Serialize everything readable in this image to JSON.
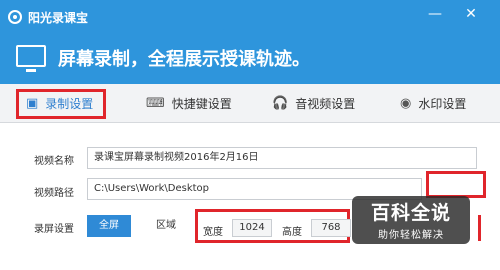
{
  "window": {
    "title": "阳光录课宝",
    "controls": [
      "—",
      "✕"
    ]
  },
  "header": {
    "slogan": "屏幕录制，全程展示授课轨迹。"
  },
  "tabs": [
    {
      "label": "录制设置",
      "icon": "camera-icon",
      "active": true
    },
    {
      "label": "快捷键设置",
      "icon": "keyboard-icon",
      "active": false
    },
    {
      "label": "音视频设置",
      "icon": "headphones-icon",
      "active": false
    },
    {
      "label": "水印设置",
      "icon": "eye-icon",
      "active": false
    }
  ],
  "form": {
    "video_name_label": "视频名称",
    "video_name_value": "录课宝屏幕录制视频2016年2月16日",
    "video_path_label": "视频路径",
    "video_path_value": "C:\\Users\\Work\\Desktop",
    "record_label": "录屏设置",
    "mode_full": "全屏",
    "mode_region": "区域",
    "width_label": "宽度",
    "width_value": "1024",
    "height_label": "高度",
    "height_value": "768"
  },
  "watermark": {
    "title": "百科全说",
    "subtitle": "助你轻松解决"
  },
  "colors": {
    "accent": "#2e95dc",
    "highlight": "#e0252b"
  }
}
